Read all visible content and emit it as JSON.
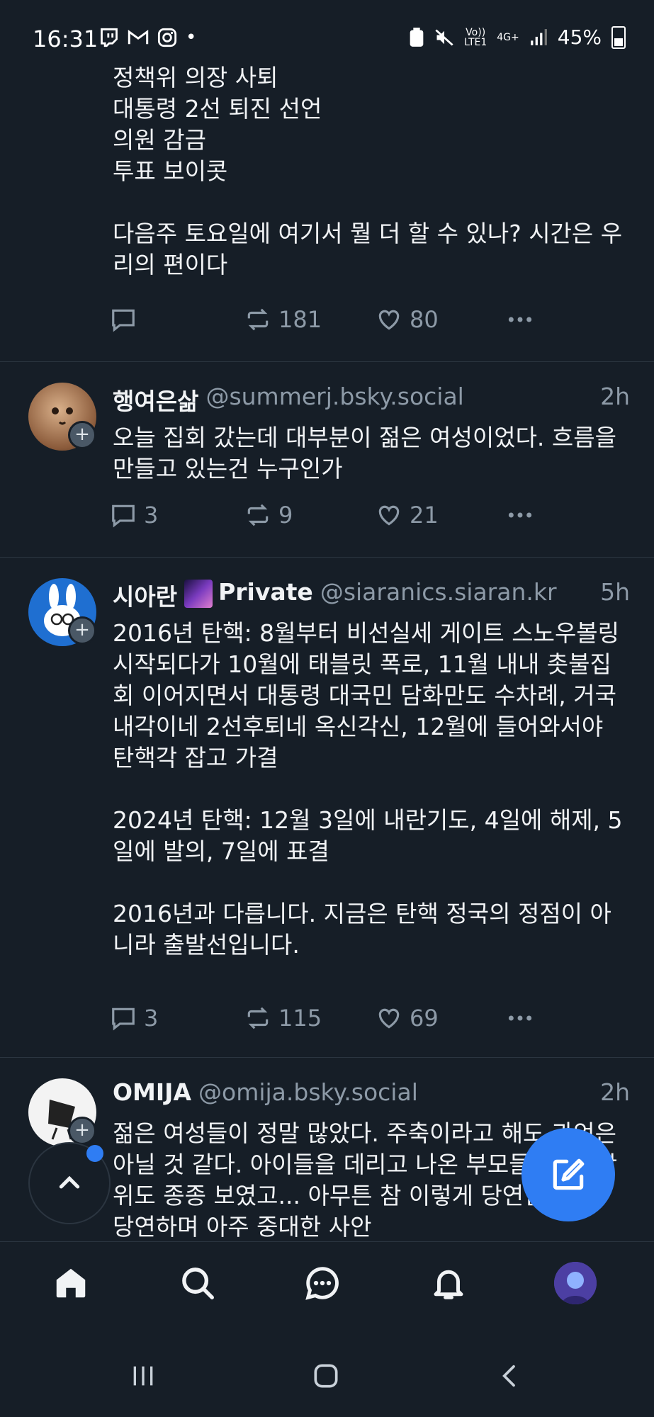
{
  "status_bar": {
    "time": "16:31",
    "app_icons": [
      "twitch-icon",
      "gmail-icon",
      "instagram-icon",
      "dot"
    ],
    "net_label_top": "Vo))",
    "net_label_bottom": "LTE1",
    "net_4g": "4G+",
    "battery": "45%"
  },
  "posts": [
    {
      "body": "정책위 의장 사퇴\n대통령 2선 퇴진 선언\n의원 감금\n투표 보이콧\n\n다음주 토요일에 여기서 뭘 더 할 수 있나? 시간은 우리의 편이다",
      "replies": "",
      "reposts": "181",
      "likes": "80"
    },
    {
      "name": "행여은삶",
      "handle": "@summerj.bsky.social",
      "time": "2h",
      "body": "오늘 집회 갔는데 대부분이 젊은 여성이었다. 흐름을 만들고 있는건 누구인가",
      "replies": "3",
      "reposts": "9",
      "likes": "21"
    },
    {
      "name": "시아란",
      "name_suffix": "Private",
      "handle": "@siaranics.siaran.kr",
      "time": "5h",
      "body": "2016년 탄핵: 8월부터 비선실세 게이트 스노우볼링 시작되다가 10월에 태블릿 폭로, 11월 내내 촛불집회 이어지면서 대통령 대국민 담화만도 수차례, 거국내각이네 2선후퇴네 옥신각신, 12월에 들어와서야 탄핵각 잡고 가결\n\n2024년 탄핵: 12월 3일에 내란기도, 4일에 해제, 5일에 발의, 7일에 표결\n\n2016년과 다릅니다. 지금은 탄핵 정국의 정점이 아니라 출발선입니다.",
      "replies": "3",
      "reposts": "115",
      "likes": "69"
    },
    {
      "name": "OMIJA",
      "handle": "@omija.bsky.social",
      "time": "2h",
      "body": "젊은 여성들이 정말 많았다. 주축이라고 해도 과언은 아닐 것 같다. 아이들을 데리고 나온 부모들, 가족 단위도 종종 보였고... 아무튼 참 이렇게 당연한 문제, 당연하며 아주 중대한 사안"
    }
  ],
  "colors": {
    "background": "#161e27",
    "accent": "#2f7df3",
    "muted": "#8d9aa7"
  },
  "nav": [
    "home-icon",
    "search-icon",
    "chat-icon",
    "bell-icon",
    "profile-avatar"
  ]
}
